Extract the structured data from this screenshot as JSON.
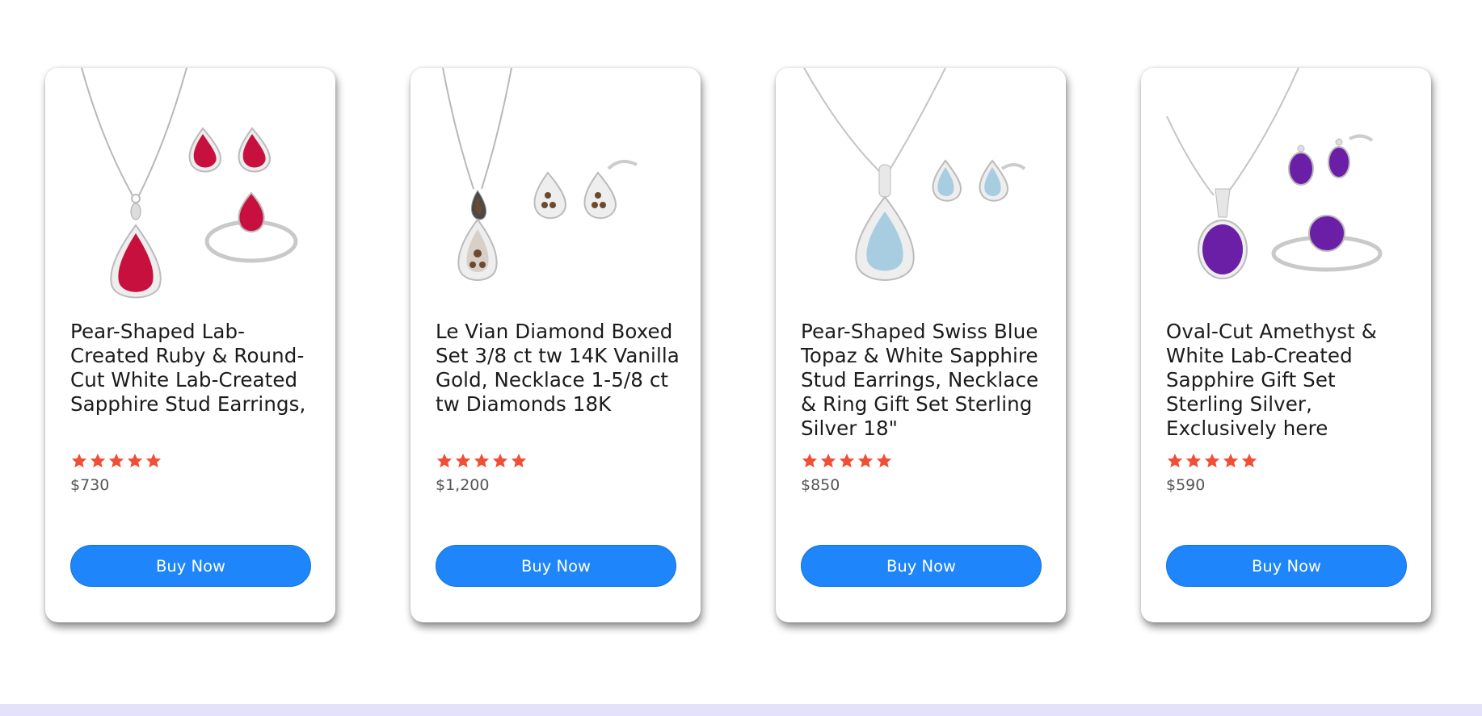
{
  "colors": {
    "accent": "#1e85fb",
    "star": "#f04e36",
    "band": "#e3e1fc"
  },
  "products": [
    {
      "title": "Pear-Shaped Lab-Created Ruby & Round-Cut White Lab-Created Sapphire Stud Earrings,",
      "rating": 5,
      "price": "$730",
      "button": "Buy Now",
      "gem_color": "#c8103f",
      "image_icon": "ruby-jewelry-set"
    },
    {
      "title": "Le Vian Diamond Boxed Set 3/8 ct tw 14K Vanilla Gold, Necklace 1-5/8 ct tw Diamonds 18K",
      "rating": 5,
      "price": "$1,200",
      "button": "Buy Now",
      "gem_color": "#6b4a2e",
      "image_icon": "chocolate-diamond-set"
    },
    {
      "title": "Pear-Shaped Swiss Blue Topaz & White Sapphire Stud Earrings, Necklace & Ring Gift Set Sterling Silver 18\"",
      "rating": 5,
      "price": "$850",
      "button": "Buy Now",
      "gem_color": "#a9cde0",
      "image_icon": "blue-topaz-set"
    },
    {
      "title": "Oval-Cut Amethyst & White Lab-Created Sapphire Gift Set Sterling Silver, Exclusively here",
      "rating": 5,
      "price": "$590",
      "button": "Buy Now",
      "gem_color": "#6a1fa6",
      "image_icon": "amethyst-jewelry-set"
    }
  ]
}
